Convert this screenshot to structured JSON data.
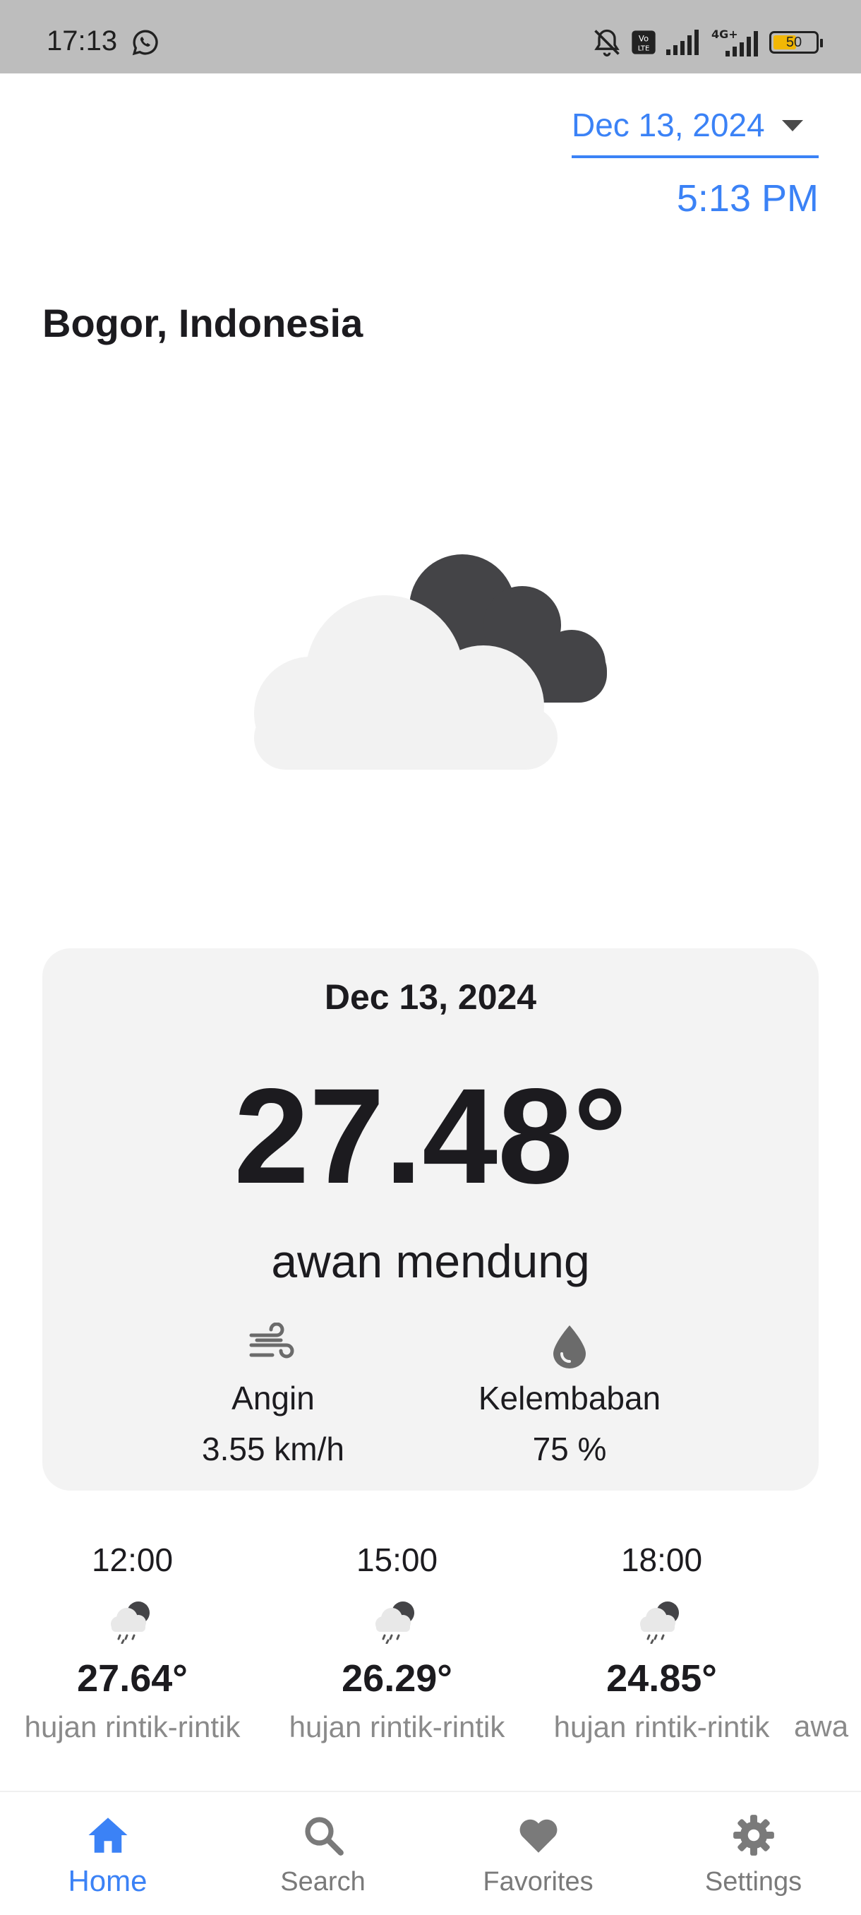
{
  "status_bar": {
    "time": "17:13",
    "battery": "50",
    "icons": [
      "whatsapp-icon",
      "bell-off-icon",
      "volte-icon",
      "signal-icon",
      "4g-signal-icon",
      "battery-icon"
    ]
  },
  "header": {
    "date": "Dec 13, 2024",
    "time": "5:13 PM"
  },
  "location": "Bogor, Indonesia",
  "current": {
    "icon": "cloudy-night-icon",
    "date": "Dec 13, 2024",
    "temperature": "27.48°",
    "description": "awan mendung",
    "wind_label": "Angin",
    "wind_value": "3.55 km/h",
    "humidity_label": "Kelembaban",
    "humidity_value": "75 %"
  },
  "hourly": [
    {
      "time": "12:00",
      "temp": "27.64°",
      "desc": "hujan rintik-rintik",
      "icon": "drizzle-night-icon"
    },
    {
      "time": "15:00",
      "temp": "26.29°",
      "desc": "hujan rintik-rintik",
      "icon": "drizzle-night-icon"
    },
    {
      "time": "18:00",
      "temp": "24.85°",
      "desc": "hujan rintik-rintik",
      "icon": "drizzle-night-icon"
    },
    {
      "time": "",
      "temp": "",
      "desc": "awa",
      "icon": ""
    }
  ],
  "nav": {
    "home": "Home",
    "search": "Search",
    "favorites": "Favorites",
    "settings": "Settings"
  },
  "colors": {
    "accent": "#3b82f6",
    "card_bg": "#f3f3f3",
    "muted_text": "#8a8a8a",
    "status_bar": "#bdbdbd"
  }
}
